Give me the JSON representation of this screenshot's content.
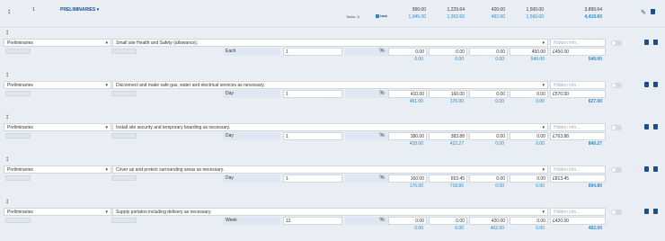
{
  "header": {
    "index": "1",
    "title": "PRELIMINARIES",
    "tasks_label": "Tasks: 8",
    "add_task_label": "task",
    "top_values": [
      "950.00",
      "1,229.64",
      "420.00",
      "1,500.00"
    ],
    "bottom_values": [
      "1,045.00",
      "1,352.60",
      "462.00",
      "1,560.00"
    ],
    "total_top": "3,899.64",
    "total_bottom": "4,419.60"
  },
  "items": [
    {
      "category": "Preliminaries",
      "description": "Small site Health and Safety (allowance).",
      "unit": "Each",
      "qty": "1",
      "pct": "100",
      "v1": "0.00",
      "v2": "0.00",
      "v3": "0.00",
      "v4": "450.00",
      "b1": "0.00",
      "b2": "0.00",
      "b3": "0.00",
      "b4": "540.00",
      "line_total": "£450.00",
      "grand": "540.00",
      "hidden_placeholder": "Hidden info...",
      "pill1": "",
      "pill2": ""
    },
    {
      "category": "Preliminaries",
      "description": "Disconnect and make safe gas, water and electrical services as necessary.",
      "unit": "Day",
      "qty": "1",
      "pct": "100",
      "v1": "410.00",
      "v2": "160.00",
      "v3": "0.00",
      "v4": "0.00",
      "b1": "451.00",
      "b2": "176.00",
      "b3": "0.00",
      "b4": "0.00",
      "line_total": "£570.00",
      "grand": "627.00",
      "hidden_placeholder": "Hidden info...",
      "pill1": "",
      "pill2": ""
    },
    {
      "category": "Preliminaries",
      "description": "Install site security and temporary boarding as necessary.",
      "unit": "Day",
      "qty": "1",
      "pct": "100",
      "v1": "380.00",
      "v2": "383.88",
      "v3": "0.00",
      "v4": "0.00",
      "b1": "418.00",
      "b2": "422.27",
      "b3": "0.00",
      "b4": "0.00",
      "line_total": "£763.88",
      "grand": "840.27",
      "hidden_placeholder": "Hidden info...",
      "pill1": "",
      "pill2": ""
    },
    {
      "category": "Preliminaries",
      "description": "Cover up and protect surrounding areas as necessary.",
      "unit": "Day",
      "qty": "1",
      "pct": "100",
      "v1": "160.00",
      "v2": "653.45",
      "v3": "0.00",
      "v4": "0.00",
      "b1": "176.00",
      "b2": "718.80",
      "b3": "0.00",
      "b4": "0.00",
      "line_total": "£813.45",
      "grand": "894.80",
      "hidden_placeholder": "Hidden info...",
      "pill1": "",
      "pill2": ""
    },
    {
      "category": "Preliminaries",
      "description": "Supply portaloo including delivery as necessary.",
      "unit": "Week",
      "qty": "12",
      "pct": "100",
      "v1": "0.00",
      "v2": "0.00",
      "v3": "420.00",
      "v4": "0.00",
      "b1": "0.00",
      "b2": "0.00",
      "b3": "462.00",
      "b4": "0.00",
      "line_total": "£420.00",
      "grand": "462.00",
      "hidden_placeholder": "Hidden info...",
      "pill1": "",
      "pill2": ""
    }
  ],
  "colors": {
    "blue": "#2a8ac9",
    "navy": "#1d4e89"
  },
  "icons": [
    "drag-handle-icon",
    "pencil-icon",
    "trash-icon",
    "copy-icon",
    "task-add-icon"
  ]
}
